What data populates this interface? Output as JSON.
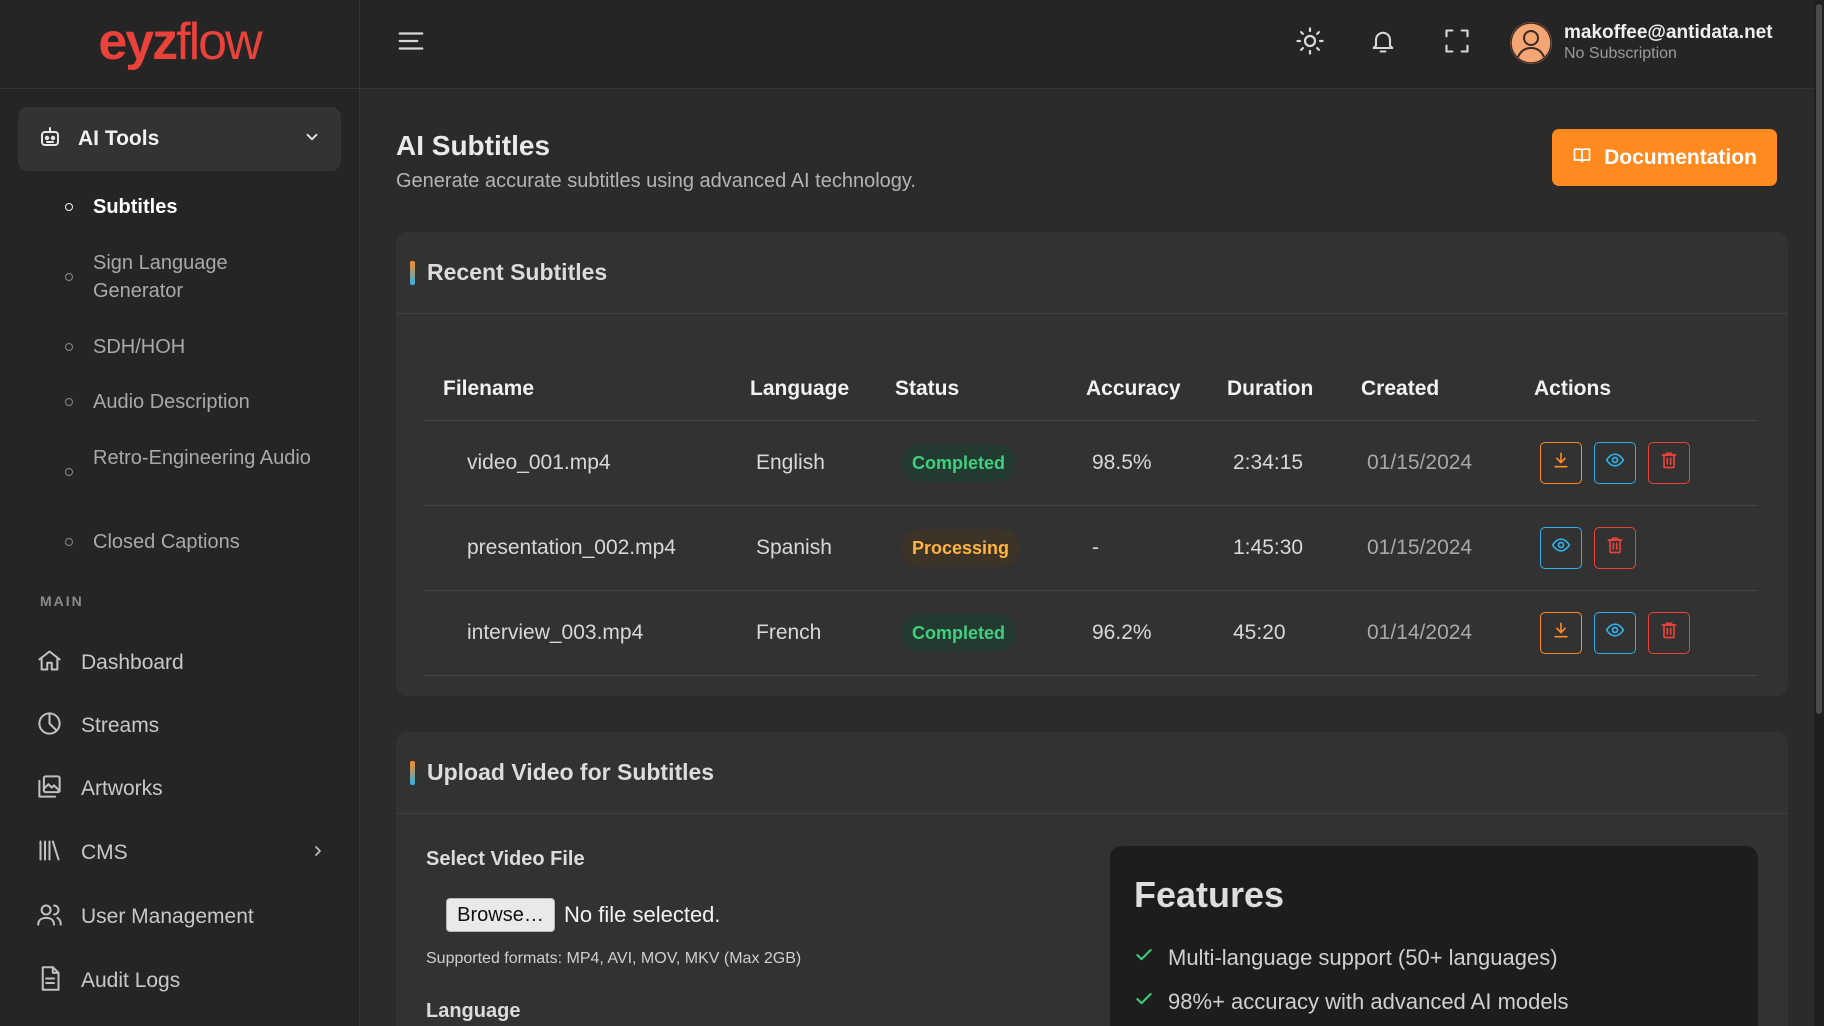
{
  "brand": {
    "part1": "eyz",
    "part2": "flow"
  },
  "sidebar": {
    "group_label": "AI Tools",
    "sub_items": [
      {
        "label": "Subtitles",
        "active": true
      },
      {
        "label": "Sign Language Generator",
        "active": false
      },
      {
        "label": "SDH/HOH",
        "active": false
      },
      {
        "label": "Audio Description",
        "active": false
      },
      {
        "label": "Retro-Engineering Audio",
        "active": false
      },
      {
        "label": "Closed Captions",
        "active": false
      }
    ],
    "section_label": "MAIN",
    "nav_items": [
      {
        "label": "Dashboard",
        "icon": "home-icon"
      },
      {
        "label": "Streams",
        "icon": "pie-chart-icon"
      },
      {
        "label": "Artworks",
        "icon": "images-icon"
      },
      {
        "label": "CMS",
        "icon": "library-icon"
      },
      {
        "label": "User Management",
        "icon": "users-icon"
      },
      {
        "label": "Audit Logs",
        "icon": "document-icon"
      }
    ]
  },
  "topbar": {
    "user_email": "makoffee@antidata.net",
    "user_plan": "No Subscription"
  },
  "page": {
    "title": "AI Subtitles",
    "subtitle": "Generate accurate subtitles using advanced AI technology.",
    "doc_button": "Documentation"
  },
  "recent": {
    "title": "Recent Subtitles",
    "columns": [
      "Filename",
      "Language",
      "Status",
      "Accuracy",
      "Duration",
      "Created",
      "Actions"
    ],
    "rows": [
      {
        "filename": "video_001.mp4",
        "language": "English",
        "status": "Completed",
        "accuracy": "98.5%",
        "duration": "2:34:15",
        "created": "01/15/2024"
      },
      {
        "filename": "presentation_002.mp4",
        "language": "Spanish",
        "status": "Processing",
        "accuracy": "-",
        "duration": "1:45:30",
        "created": "01/15/2024"
      },
      {
        "filename": "interview_003.mp4",
        "language": "French",
        "status": "Completed",
        "accuracy": "96.2%",
        "duration": "45:20",
        "created": "01/14/2024"
      }
    ]
  },
  "upload": {
    "title": "Upload Video for Subtitles",
    "file_label": "Select Video File",
    "browse_label": "Browse…",
    "no_file": "No file selected.",
    "formats_hint": "Supported formats: MP4, AVI, MOV, MKV (Max 2GB)",
    "language_label": "Language"
  },
  "features": {
    "title": "Features",
    "items": [
      "Multi-language support (50+ languages)",
      "98%+ accuracy with advanced AI models"
    ]
  },
  "colors": {
    "accent": "#ff8a1f",
    "brand": "#e9423a",
    "info": "#2fb0e8",
    "success": "#3fd07f"
  }
}
